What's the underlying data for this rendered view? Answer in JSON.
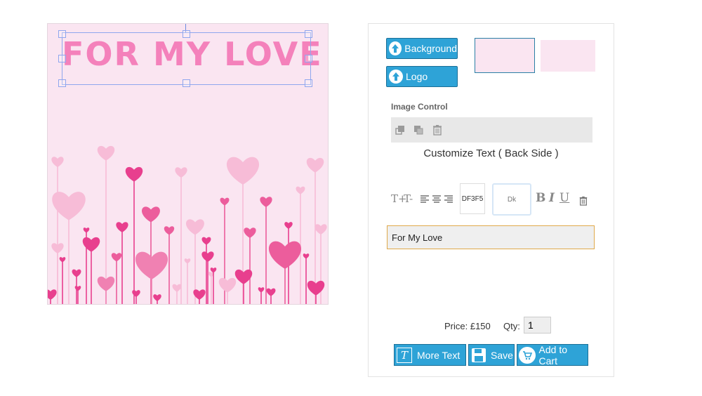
{
  "canvas": {
    "text": "For My Love",
    "text_color": "#f481bb",
    "background_color": "#fae5f1"
  },
  "panel": {
    "background_button_label": "Background",
    "logo_button_label": "Logo",
    "upload_icon": "upload-arrow-icon",
    "image_control_label": "Image Control",
    "image_control_tools": [
      "bring-forward-icon",
      "send-backward-icon",
      "trash-icon"
    ],
    "customize_title": "Customize Text ( Back Side )",
    "text_tools": {
      "increase_size": "T+",
      "decrease_size": "T-",
      "align_icons": [
        "align-left-icon",
        "align-center-icon",
        "align-right-icon"
      ],
      "color_value": "DF3F5",
      "font_value": "Dk",
      "bold": "B",
      "italic": "I",
      "underline": "U"
    },
    "text_input_value": "For My Love",
    "price_text": "Price: £150",
    "qty_label": "Qty:",
    "qty_value": "1",
    "more_text_label": "More Text",
    "save_label": "Save",
    "add_to_cart_label": "Add to Cart",
    "accent_color": "#2ea3d7"
  }
}
